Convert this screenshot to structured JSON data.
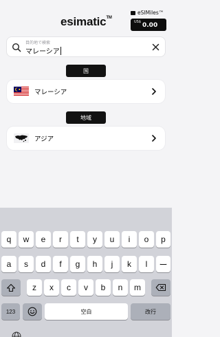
{
  "header": {
    "logo_text": "esimatic",
    "logo_tm": "TM",
    "miles_label": "eSIMiles™",
    "miles_currency": "US$",
    "miles_amount": "0.00"
  },
  "search": {
    "hint": "目的地で検索",
    "value": "マレーシア"
  },
  "sections": {
    "country_tag": "国",
    "region_tag": "地域"
  },
  "results": {
    "country_label": "マレーシア",
    "region_label": "アジア"
  },
  "keyboard": {
    "row1": [
      "q",
      "w",
      "e",
      "r",
      "t",
      "y",
      "u",
      "i",
      "o",
      "p"
    ],
    "row2": [
      "a",
      "s",
      "d",
      "f",
      "g",
      "h",
      "j",
      "k",
      "l",
      "ー"
    ],
    "row3": [
      "z",
      "x",
      "c",
      "v",
      "b",
      "n",
      "m"
    ],
    "numbers_key": "123",
    "space_key": "空白",
    "return_key": "改行"
  },
  "icons": {
    "search": "search-icon",
    "clear": "close-icon",
    "chevron": "chevron-right-icon",
    "shift": "shift-icon",
    "delete": "backspace-icon",
    "emoji": "emoji-icon",
    "globe": "globe-icon",
    "wallet": "wallet-icon"
  }
}
